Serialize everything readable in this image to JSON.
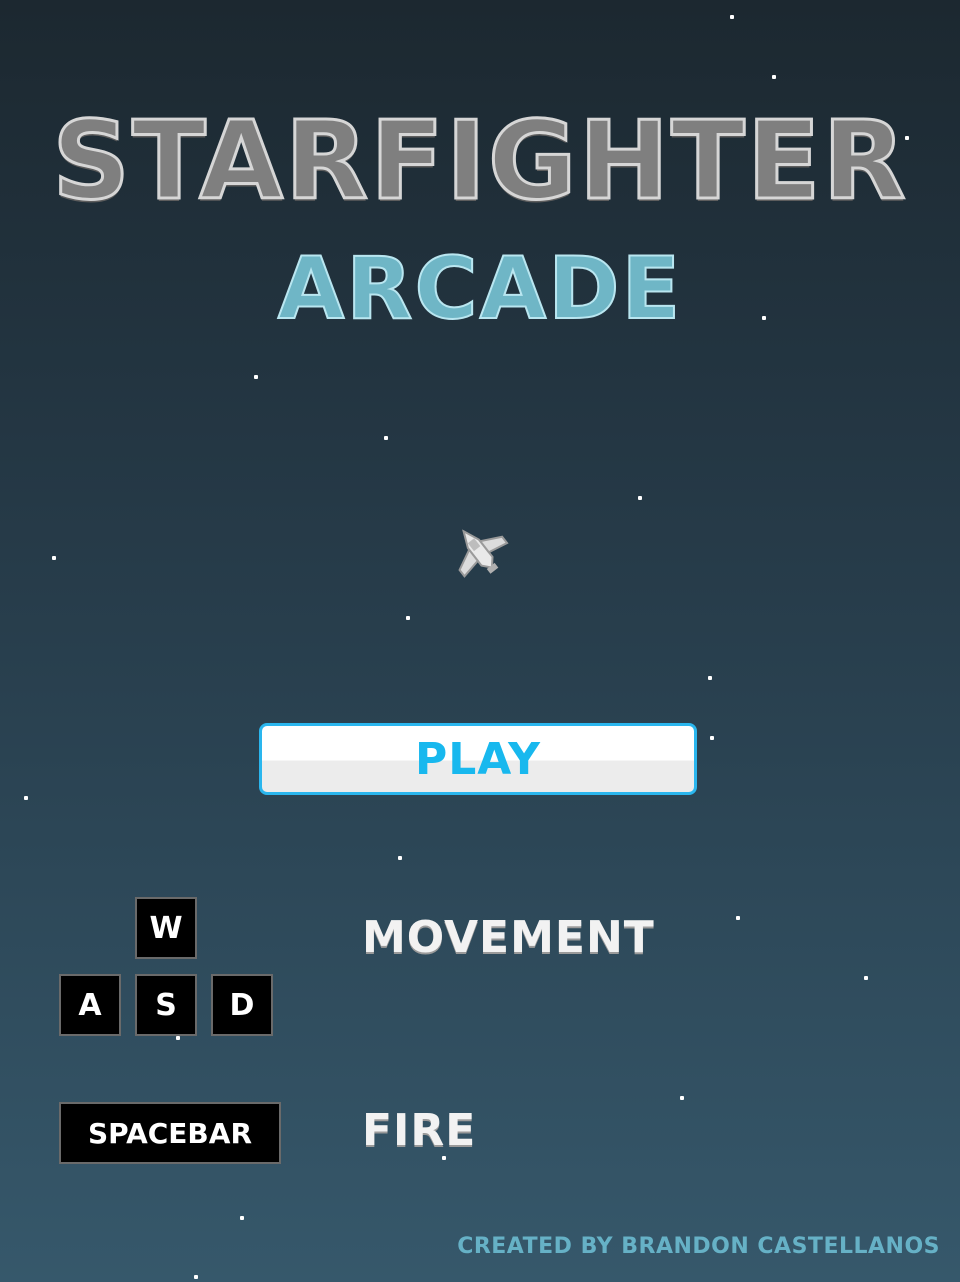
{
  "title": {
    "main": "STARFIGHTER",
    "sub": "ARCADE"
  },
  "menu": {
    "play_label": "PLAY"
  },
  "controls": {
    "movement_keys": {
      "up": "W",
      "left": "A",
      "down": "S",
      "right": "D"
    },
    "movement_label": "MOVEMENT",
    "fire_key": "SPACEBAR",
    "fire_label": "FIRE"
  },
  "credits": "CREATED BY BRANDON CASTELLANOS",
  "icons": {
    "player_ship": "spaceship-icon",
    "background_stars": "star-icon"
  },
  "colors": {
    "title_main": "#7f7f7f",
    "title_sub": "#6fb6c6",
    "play_accent": "#18b8ee",
    "credits": "#66b1c6"
  }
}
